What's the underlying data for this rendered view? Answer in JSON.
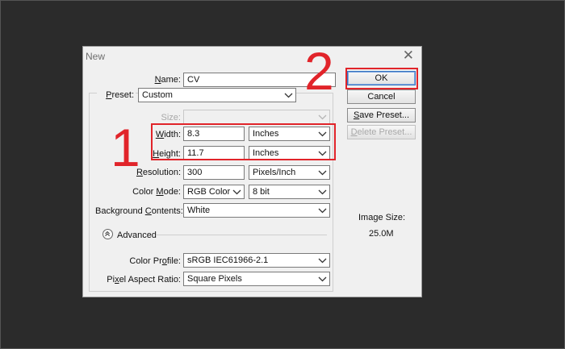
{
  "dialog": {
    "title": "New",
    "name_label": "Name:",
    "name_value": "CV",
    "preset_label": "Preset:",
    "preset_value": "Custom",
    "size_label": "Size:",
    "width_label": "Width:",
    "width_value": "8.3",
    "width_unit": "Inches",
    "height_label": "Height:",
    "height_value": "11.7",
    "height_unit": "Inches",
    "resolution_label": "Resolution:",
    "resolution_value": "300",
    "resolution_unit": "Pixels/Inch",
    "color_mode_label": "Color Mode:",
    "color_mode_value": "RGB Color",
    "bit_depth_value": "8 bit",
    "background_label": "Background Contents:",
    "background_value": "White",
    "advanced_label": "Advanced",
    "color_profile_label": "Color Profile:",
    "color_profile_value": "sRGB IEC61966-2.1",
    "pixel_aspect_label": "Pixel Aspect Ratio:",
    "pixel_aspect_value": "Square Pixels"
  },
  "buttons": {
    "ok": "OK",
    "cancel": "Cancel",
    "save_preset": "Save Preset...",
    "delete_preset": "Delete Preset..."
  },
  "image_size": {
    "label": "Image Size:",
    "value": "25.0M"
  },
  "annotations": {
    "step1": "1",
    "step2": "2",
    "highlight_color": "#e1242a"
  }
}
